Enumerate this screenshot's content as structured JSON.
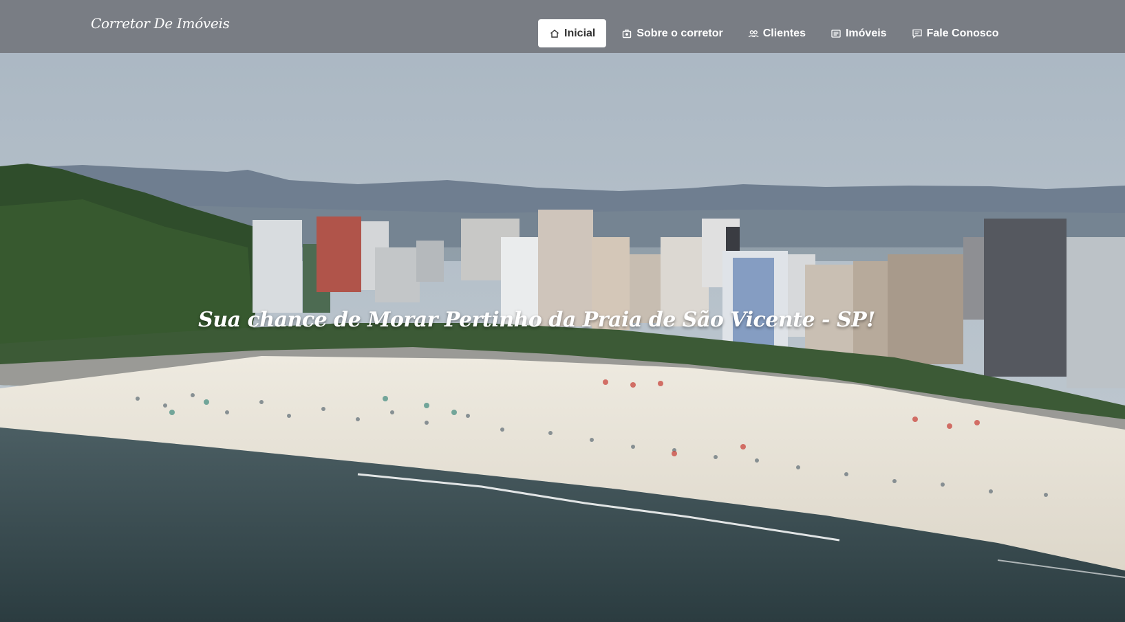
{
  "brand": {
    "name": "Corretor De Imóveis"
  },
  "nav": {
    "items": [
      {
        "label": "Inicial",
        "icon": "home-icon",
        "active": true
      },
      {
        "label": "Sobre o corretor",
        "icon": "briefcase-icon",
        "active": false
      },
      {
        "label": "Clientes",
        "icon": "users-icon",
        "active": false
      },
      {
        "label": "Imóveis",
        "icon": "list-icon",
        "active": false
      },
      {
        "label": "Fale Conosco",
        "icon": "chat-icon",
        "active": false
      }
    ]
  },
  "hero": {
    "headline": "Sua chance de Morar Pertinho da Praia de São Vicente - SP!"
  },
  "colors": {
    "navbar_bg": "#6e7076",
    "active_bg": "#ffffff",
    "sky": "#b8c4ce",
    "sea": "#2f4347",
    "sand": "#ece8dd"
  }
}
